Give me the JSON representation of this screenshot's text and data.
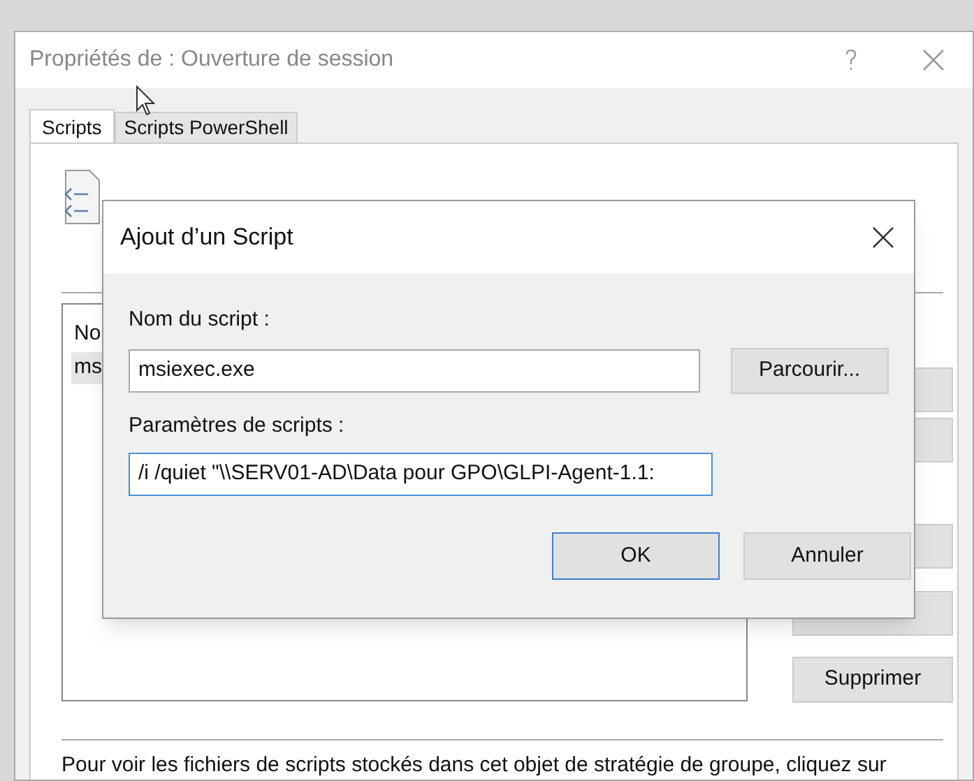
{
  "window": {
    "title": "Propriétés de : Ouverture de session"
  },
  "tabs": [
    {
      "label": "Scripts",
      "selected": true
    },
    {
      "label": "Scripts PowerShell",
      "selected": false
    }
  ],
  "list": {
    "header": "No",
    "row": "ms"
  },
  "side_buttons": [
    {
      "label": "Supprimer"
    }
  ],
  "footer": "Pour voir les fichiers de scripts stockés dans cet objet de stratégie de groupe, cliquez sur",
  "dialog": {
    "title": "Ajout d’un Script",
    "fields": [
      {
        "label": "Nom du script :",
        "value": "msiexec.exe",
        "focused": false,
        "button": "Parcourir..."
      },
      {
        "label": "Paramètres de scripts :",
        "value": "/i /quiet \"\\\\SERV01-AD\\Data pour GPO\\GLPI-Agent-1.1:",
        "focused": true
      }
    ],
    "buttons": [
      {
        "label": "OK",
        "default": true
      },
      {
        "label": "Annuler",
        "default": false
      }
    ]
  }
}
